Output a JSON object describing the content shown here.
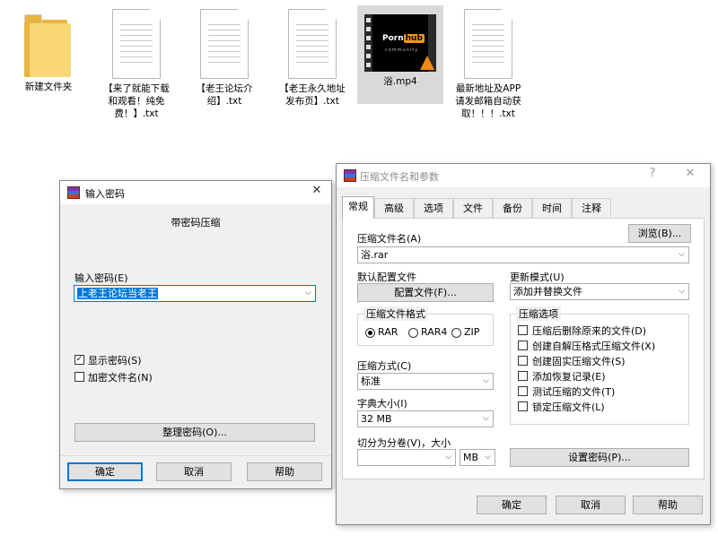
{
  "desktop": {
    "files": [
      {
        "label": "新建文件夹",
        "type": "folder"
      },
      {
        "label": "【来了就能下载\n和观看！纯免\n费！】.txt",
        "type": "txt"
      },
      {
        "label": "【老王论坛介\n绍】.txt",
        "type": "txt"
      },
      {
        "label": "【老王永久地址\n发布页】.txt",
        "type": "txt"
      },
      {
        "label": "浴.mp4",
        "type": "video",
        "thumb_brand": "Porn",
        "thumb_brand_box": "hub",
        "thumb_sub": "community"
      },
      {
        "label": "最新地址及APP\n请发邮箱自动获\n取！！！.txt",
        "type": "txt"
      }
    ]
  },
  "password_dialog": {
    "title": "输入密码",
    "close": "✕",
    "heading": "带密码压缩",
    "password_label": "输入密码(E)",
    "password_value": "上老王论坛当老王",
    "show_password": "显示密码(S)",
    "encrypt_names": "加密文件名(N)",
    "organize": "整理密码(O)...",
    "ok": "确定",
    "cancel": "取消",
    "help": "帮助"
  },
  "archive_dialog": {
    "title": "压缩文件名和参数",
    "help_ctrl": "?",
    "close": "✕",
    "tabs": [
      "常规",
      "高级",
      "选项",
      "文件",
      "备份",
      "时间",
      "注释"
    ],
    "archive_name_label": "压缩文件名(A)",
    "browse": "浏览(B)...",
    "archive_name_value": "浴.rar",
    "default_profile_label": "默认配置文件",
    "profiles_button": "配置文件(F)...",
    "update_mode_label": "更新模式(U)",
    "update_mode_value": "添加并替换文件",
    "format_group": "压缩文件格式",
    "formats": [
      "RAR",
      "RAR4",
      "ZIP"
    ],
    "method_label": "压缩方式(C)",
    "method_value": "标准",
    "dict_label": "字典大小(I)",
    "dict_value": "32 MB",
    "split_label": "切分为分卷(V)，大小",
    "split_unit": "MB",
    "options_group": "压缩选项",
    "options": [
      {
        "label": "压缩后删除原来的文件(D)",
        "checked": false
      },
      {
        "label": "创建自解压格式压缩文件(X)",
        "checked": false
      },
      {
        "label": "创建固实压缩文件(S)",
        "checked": false
      },
      {
        "label": "添加恢复记录(E)",
        "checked": false
      },
      {
        "label": "测试压缩的文件(T)",
        "checked": false
      },
      {
        "label": "锁定压缩文件(L)",
        "checked": false
      }
    ],
    "set_password": "设置密码(P)...",
    "ok": "确定",
    "cancel": "取消",
    "help": "帮助"
  },
  "icons": {
    "check": "✓",
    "dropdown": "⌵"
  },
  "colors": {
    "selection": "#0078d7",
    "folder": "#f8d774",
    "folder_dark": "#e8b543"
  }
}
